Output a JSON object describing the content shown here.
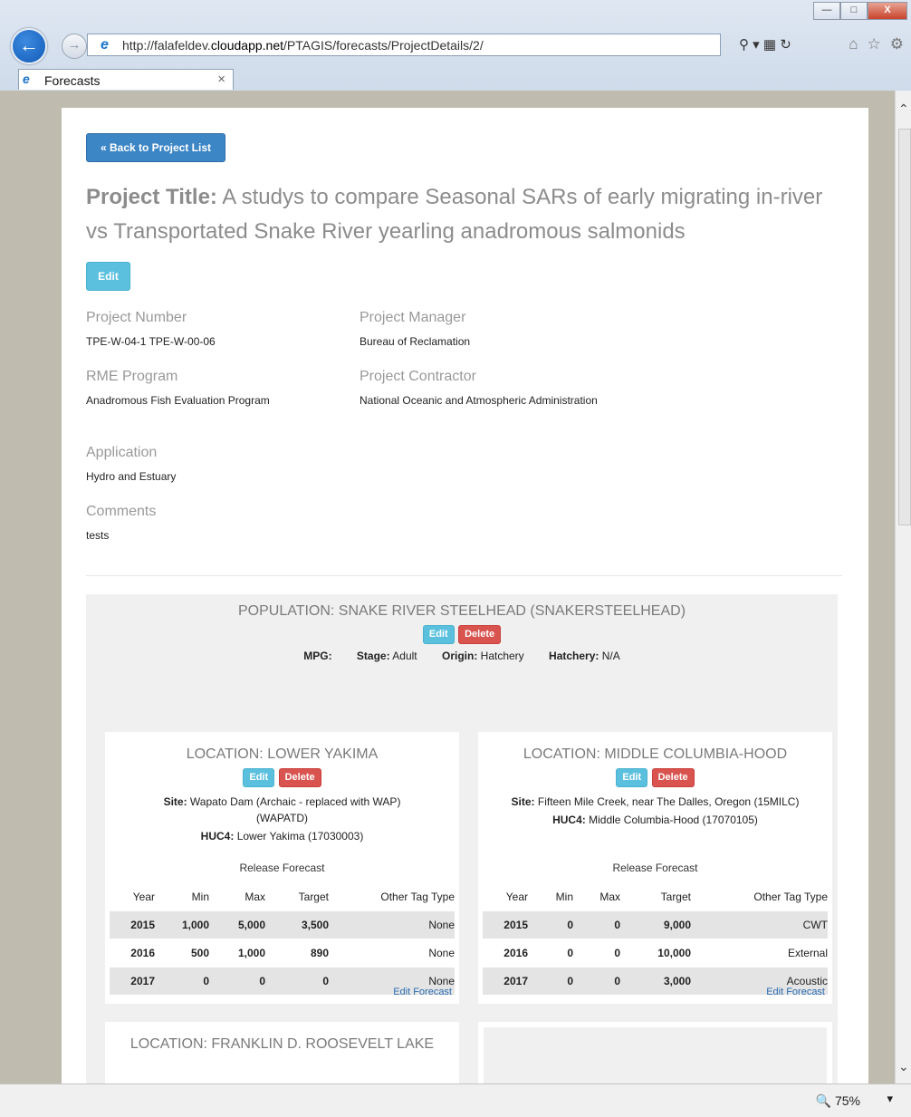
{
  "browser": {
    "url_prefix": "http://falafeldev.",
    "url_host": "cloudapp.net",
    "url_path": "/PTAGIS/forecasts/ProjectDetails/2/",
    "tab_title": "Forecasts",
    "zoom": "75%"
  },
  "page": {
    "back_label": "« Back to Project List",
    "title_label": "Project Title:",
    "title_text": "A studys to compare Seasonal SARs of early migrating in-river vs Transportated Snake River yearling anadromous salmonids",
    "edit_label": "Edit",
    "fields": {
      "project_number_label": "Project Number",
      "project_number": "TPE-W-04-1 TPE-W-00-06",
      "project_manager_label": "Project Manager",
      "project_manager": "Bureau of Reclamation",
      "rme_program_label": "RME Program",
      "rme_program": "Anadromous Fish Evaluation Program",
      "project_contractor_label": "Project Contractor",
      "project_contractor": "National Oceanic and Atmospheric Administration",
      "application_label": "Application",
      "application": "Hydro and Estuary",
      "comments_label": "Comments",
      "comments": "tests"
    }
  },
  "population": {
    "heading": "POPULATION: SNAKE RIVER STEELHEAD (SNAKERSTEELHEAD)",
    "edit_label": "Edit",
    "delete_label": "Delete",
    "mpg_label": "MPG:",
    "mpg": "",
    "stage_label": "Stage:",
    "stage": "Adult",
    "origin_label": "Origin:",
    "origin": "Hatchery",
    "hatchery_label": "Hatchery:",
    "hatchery": "N/A"
  },
  "locations": [
    {
      "heading": "LOCATION: LOWER YAKIMA",
      "edit_label": "Edit",
      "delete_label": "Delete",
      "site_label": "Site:",
      "site": "Wapato Dam (Archaic - replaced with WAP) (WAPATD)",
      "huc_label": "HUC4:",
      "huc": "Lower Yakima (17030003)",
      "release_label": "Release Forecast",
      "columns": [
        "Year",
        "Min",
        "Max",
        "Target",
        "Other Tag Type"
      ],
      "rows": [
        [
          "2015",
          "1,000",
          "5,000",
          "3,500",
          "None"
        ],
        [
          "2016",
          "500",
          "1,000",
          "890",
          "None"
        ],
        [
          "2017",
          "0",
          "0",
          "0",
          "None"
        ]
      ],
      "edit_forecast_label": "Edit Forecast"
    },
    {
      "heading": "LOCATION: MIDDLE COLUMBIA-HOOD",
      "edit_label": "Edit",
      "delete_label": "Delete",
      "site_label": "Site:",
      "site": "Fifteen Mile Creek, near The Dalles, Oregon (15MILC)",
      "huc_label": "HUC4:",
      "huc": "Middle Columbia-Hood (17070105)",
      "release_label": "Release Forecast",
      "columns": [
        "Year",
        "Min",
        "Max",
        "Target",
        "Other Tag Type"
      ],
      "rows": [
        [
          "2015",
          "0",
          "0",
          "9,000",
          "CWT"
        ],
        [
          "2016",
          "0",
          "0",
          "10,000",
          "External"
        ],
        [
          "2017",
          "0",
          "0",
          "3,000",
          "Acoustic"
        ]
      ],
      "edit_forecast_label": "Edit Forecast"
    },
    {
      "heading": "LOCATION: FRANKLIN D. ROOSEVELT LAKE"
    }
  ]
}
